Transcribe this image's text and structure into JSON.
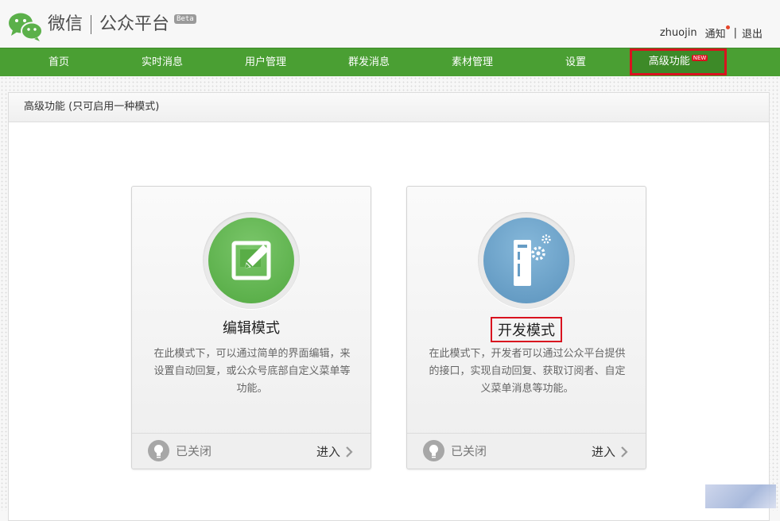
{
  "header": {
    "brand_name": "微信",
    "brand_sub": "公众平台",
    "beta": "Beta",
    "user": "zhuojin",
    "notice": "通知",
    "separator": "|",
    "logout": "退出"
  },
  "nav": {
    "items": [
      {
        "label": "首页"
      },
      {
        "label": "实时消息"
      },
      {
        "label": "用户管理"
      },
      {
        "label": "群发消息"
      },
      {
        "label": "素材管理"
      },
      {
        "label": "设置"
      },
      {
        "label": "高级功能",
        "badge": "NEW",
        "active": true
      }
    ]
  },
  "panel": {
    "title": "高级功能 (只可启用一种模式)"
  },
  "cards": [
    {
      "title": "编辑模式",
      "description": "在此模式下，可以通过简单的界面编辑，来设置自动回复，或公众号底部自定义菜单等功能。",
      "status": "已关闭",
      "enter": "进入",
      "icon": "edit-icon",
      "color": "#5bb04a"
    },
    {
      "title": "开发模式",
      "description": "在此模式下，开发者可以通过公众平台提供的接口，实现自动回复、获取订阅者、自定义菜单消息等功能。",
      "status": "已关闭",
      "enter": "进入",
      "icon": "server-gear-icon",
      "color": "#679dc5"
    }
  ],
  "colors": {
    "nav_bg": "#4a9f33",
    "highlight": "#d9121f"
  }
}
